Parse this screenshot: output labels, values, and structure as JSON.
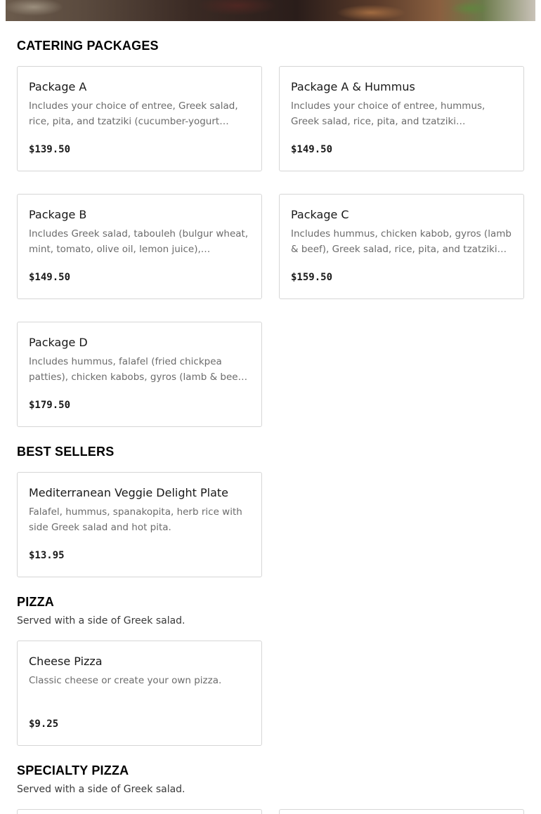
{
  "sections": {
    "catering": {
      "title": "CATERING PACKAGES",
      "items": [
        {
          "name": "Package A",
          "desc": "Includes your choice of entree, Greek salad, rice, pita, and tzatziki (cucumber-yogurt sauce).",
          "price": "$139.50"
        },
        {
          "name": "Package A & Hummus",
          "desc": "Includes your choice of entree, hummus, Greek salad, rice, pita, and tzatziki (cucumber-yogurt…",
          "price": "$149.50"
        },
        {
          "name": "Package B",
          "desc": "Includes Greek salad, tabouleh (bulgur wheat, mint, tomato, olive oil, lemon juice), hummus,…",
          "price": "$149.50"
        },
        {
          "name": "Package C",
          "desc": "Includes hummus, chicken kabob, gyros (lamb & beef), Greek salad, rice, pita, and tzatziki…",
          "price": "$159.50"
        },
        {
          "name": "Package D",
          "desc": "Includes hummus, falafel (fried chickpea patties), chicken kabobs, gyros (lamb & beef), dolma…",
          "price": "$179.50"
        }
      ]
    },
    "best_sellers": {
      "title": "BEST SELLERS",
      "items": [
        {
          "name": "Mediterranean Veggie Delight Plate",
          "desc": "Falafel, hummus, spanakopita, herb rice with side Greek salad and hot pita.",
          "price": "$13.95"
        }
      ]
    },
    "pizza": {
      "title": "PIZZA",
      "subtitle": "Served with a side of Greek salad.",
      "items": [
        {
          "name": "Cheese Pizza",
          "desc": "Classic cheese or create your own pizza.",
          "price": "$9.25"
        }
      ]
    },
    "specialty_pizza": {
      "title": "SPECIALTY PIZZA",
      "subtitle": "Served with a side of Greek salad."
    }
  }
}
